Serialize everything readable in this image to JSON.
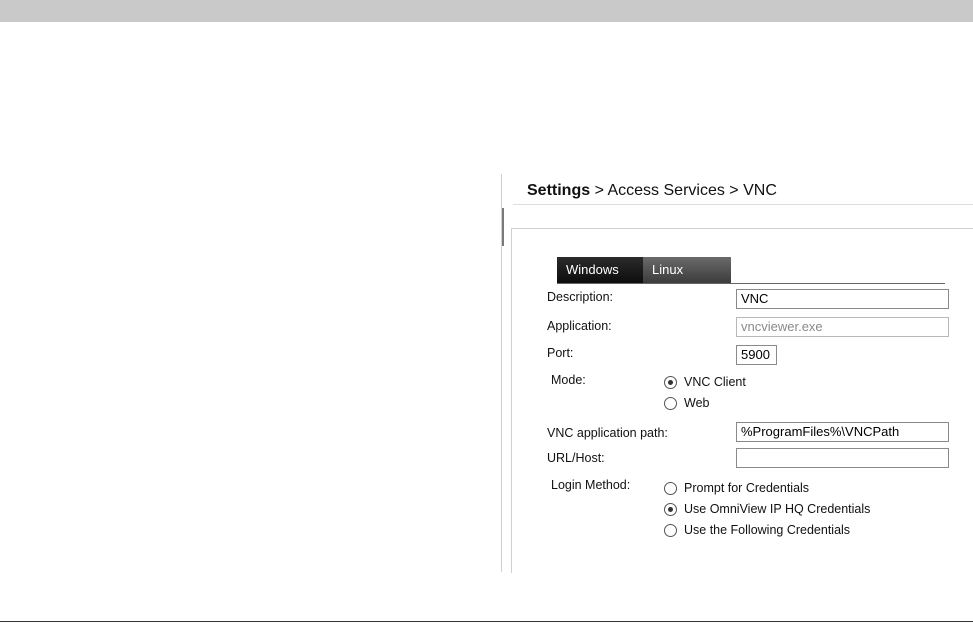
{
  "breadcrumb": {
    "root": "Settings",
    "separator1": " > ",
    "section": "Access Services",
    "separator2": " > ",
    "page": "VNC"
  },
  "tabs": [
    {
      "label": "Windows",
      "selected": false
    },
    {
      "label": "Linux",
      "selected": true
    }
  ],
  "form": {
    "description": {
      "label": "Description:",
      "value": "VNC"
    },
    "application": {
      "label": "Application:",
      "value": "vncviewer.exe"
    },
    "port": {
      "label": "Port:",
      "value": "5900"
    },
    "mode": {
      "label": "Mode:",
      "options": [
        {
          "label": "VNC Client",
          "checked": true
        },
        {
          "label": "Web",
          "checked": false
        }
      ]
    },
    "vnc_path": {
      "label": "VNC application path:",
      "value": "%ProgramFiles%\\VNCPath"
    },
    "url_host": {
      "label": "URL/Host:",
      "value": ""
    },
    "login_method": {
      "label": "Login Method:",
      "options": [
        {
          "label": "Prompt for Credentials",
          "checked": false
        },
        {
          "label": "Use OmniView IP HQ Credentials",
          "checked": true
        },
        {
          "label": "Use the Following Credentials",
          "checked": false
        }
      ]
    }
  }
}
